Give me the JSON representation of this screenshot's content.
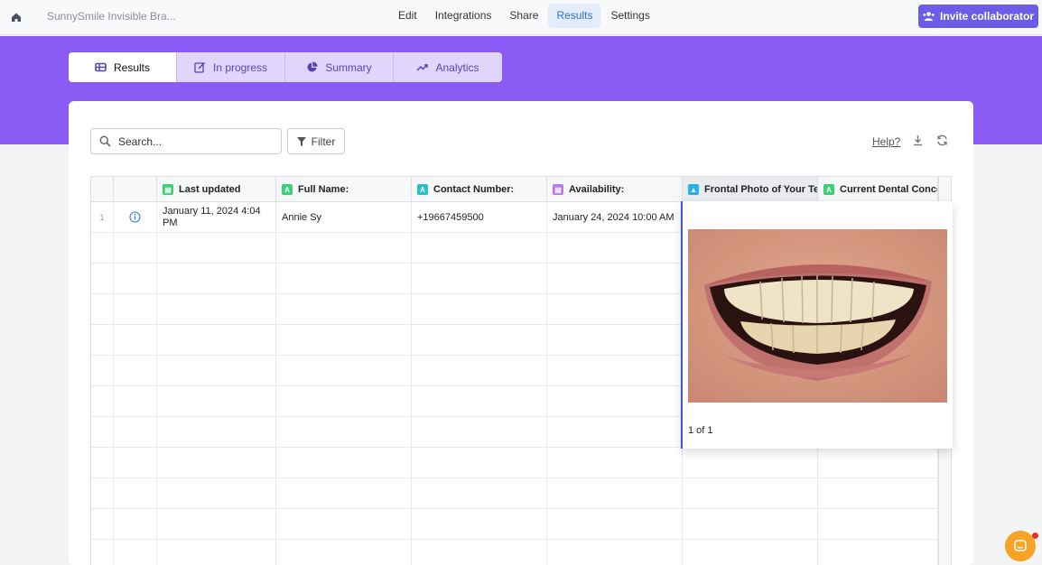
{
  "topnav": {
    "form_title": "SunnySmile Invisible Bra...",
    "links": [
      "Edit",
      "Integrations",
      "Share",
      "Results",
      "Settings"
    ],
    "active_link": "Results",
    "invite_label": "Invite collaborator"
  },
  "tabs": [
    {
      "label": "Results",
      "icon": "table-icon",
      "active": true
    },
    {
      "label": "In progress",
      "icon": "edit-icon",
      "active": false
    },
    {
      "label": "Summary",
      "icon": "pie-chart-icon",
      "active": false
    },
    {
      "label": "Analytics",
      "icon": "trend-icon",
      "active": false
    }
  ],
  "toolbar": {
    "search_placeholder": "Search...",
    "filter_label": "Filter",
    "help_label": "Help?"
  },
  "grid": {
    "columns": [
      {
        "label": "Last updated",
        "type": "date"
      },
      {
        "label": "Full Name:",
        "type": "text"
      },
      {
        "label": "Contact Number:",
        "type": "text"
      },
      {
        "label": "Availability:",
        "type": "datetime"
      },
      {
        "label": "Frontal Photo of Your Teeth",
        "type": "image"
      },
      {
        "label": "Current Dental Concern",
        "type": "text"
      }
    ],
    "rows": [
      {
        "index": "1",
        "last_updated": "January 11, 2024 4:04 PM",
        "full_name": "Annie Sy",
        "contact_number": "+19667459500",
        "availability": "January 24, 2024 10:00 AM"
      }
    ]
  },
  "popup": {
    "pager": "1 of 1"
  },
  "colors": {
    "brand_purple": "#8a5cf5",
    "invite_button": "#6c5ce7",
    "active_link": "#2f6fcc",
    "chat_button": "#f8a325"
  }
}
